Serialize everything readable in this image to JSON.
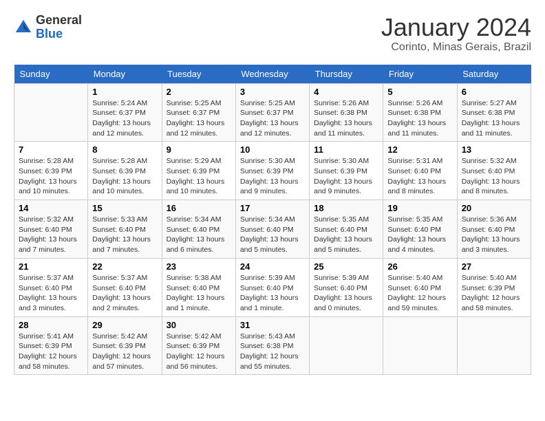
{
  "header": {
    "logo_general": "General",
    "logo_blue": "Blue",
    "month_title": "January 2024",
    "location": "Corinto, Minas Gerais, Brazil"
  },
  "weekdays": [
    "Sunday",
    "Monday",
    "Tuesday",
    "Wednesday",
    "Thursday",
    "Friday",
    "Saturday"
  ],
  "weeks": [
    [
      {
        "day": "",
        "info": ""
      },
      {
        "day": "1",
        "info": "Sunrise: 5:24 AM\nSunset: 6:37 PM\nDaylight: 13 hours and 12 minutes."
      },
      {
        "day": "2",
        "info": "Sunrise: 5:25 AM\nSunset: 6:37 PM\nDaylight: 13 hours and 12 minutes."
      },
      {
        "day": "3",
        "info": "Sunrise: 5:25 AM\nSunset: 6:37 PM\nDaylight: 13 hours and 12 minutes."
      },
      {
        "day": "4",
        "info": "Sunrise: 5:26 AM\nSunset: 6:38 PM\nDaylight: 13 hours and 11 minutes."
      },
      {
        "day": "5",
        "info": "Sunrise: 5:26 AM\nSunset: 6:38 PM\nDaylight: 13 hours and 11 minutes."
      },
      {
        "day": "6",
        "info": "Sunrise: 5:27 AM\nSunset: 6:38 PM\nDaylight: 13 hours and 11 minutes."
      }
    ],
    [
      {
        "day": "7",
        "info": "Sunrise: 5:28 AM\nSunset: 6:39 PM\nDaylight: 13 hours and 10 minutes."
      },
      {
        "day": "8",
        "info": "Sunrise: 5:28 AM\nSunset: 6:39 PM\nDaylight: 13 hours and 10 minutes."
      },
      {
        "day": "9",
        "info": "Sunrise: 5:29 AM\nSunset: 6:39 PM\nDaylight: 13 hours and 10 minutes."
      },
      {
        "day": "10",
        "info": "Sunrise: 5:30 AM\nSunset: 6:39 PM\nDaylight: 13 hours and 9 minutes."
      },
      {
        "day": "11",
        "info": "Sunrise: 5:30 AM\nSunset: 6:39 PM\nDaylight: 13 hours and 9 minutes."
      },
      {
        "day": "12",
        "info": "Sunrise: 5:31 AM\nSunset: 6:40 PM\nDaylight: 13 hours and 8 minutes."
      },
      {
        "day": "13",
        "info": "Sunrise: 5:32 AM\nSunset: 6:40 PM\nDaylight: 13 hours and 8 minutes."
      }
    ],
    [
      {
        "day": "14",
        "info": "Sunrise: 5:32 AM\nSunset: 6:40 PM\nDaylight: 13 hours and 7 minutes."
      },
      {
        "day": "15",
        "info": "Sunrise: 5:33 AM\nSunset: 6:40 PM\nDaylight: 13 hours and 7 minutes."
      },
      {
        "day": "16",
        "info": "Sunrise: 5:34 AM\nSunset: 6:40 PM\nDaylight: 13 hours and 6 minutes."
      },
      {
        "day": "17",
        "info": "Sunrise: 5:34 AM\nSunset: 6:40 PM\nDaylight: 13 hours and 5 minutes."
      },
      {
        "day": "18",
        "info": "Sunrise: 5:35 AM\nSunset: 6:40 PM\nDaylight: 13 hours and 5 minutes."
      },
      {
        "day": "19",
        "info": "Sunrise: 5:35 AM\nSunset: 6:40 PM\nDaylight: 13 hours and 4 minutes."
      },
      {
        "day": "20",
        "info": "Sunrise: 5:36 AM\nSunset: 6:40 PM\nDaylight: 13 hours and 3 minutes."
      }
    ],
    [
      {
        "day": "21",
        "info": "Sunrise: 5:37 AM\nSunset: 6:40 PM\nDaylight: 13 hours and 3 minutes."
      },
      {
        "day": "22",
        "info": "Sunrise: 5:37 AM\nSunset: 6:40 PM\nDaylight: 13 hours and 2 minutes."
      },
      {
        "day": "23",
        "info": "Sunrise: 5:38 AM\nSunset: 6:40 PM\nDaylight: 13 hours and 1 minute."
      },
      {
        "day": "24",
        "info": "Sunrise: 5:39 AM\nSunset: 6:40 PM\nDaylight: 13 hours and 1 minute."
      },
      {
        "day": "25",
        "info": "Sunrise: 5:39 AM\nSunset: 6:40 PM\nDaylight: 13 hours and 0 minutes."
      },
      {
        "day": "26",
        "info": "Sunrise: 5:40 AM\nSunset: 6:40 PM\nDaylight: 12 hours and 59 minutes."
      },
      {
        "day": "27",
        "info": "Sunrise: 5:40 AM\nSunset: 6:39 PM\nDaylight: 12 hours and 58 minutes."
      }
    ],
    [
      {
        "day": "28",
        "info": "Sunrise: 5:41 AM\nSunset: 6:39 PM\nDaylight: 12 hours and 58 minutes."
      },
      {
        "day": "29",
        "info": "Sunrise: 5:42 AM\nSunset: 6:39 PM\nDaylight: 12 hours and 57 minutes."
      },
      {
        "day": "30",
        "info": "Sunrise: 5:42 AM\nSunset: 6:39 PM\nDaylight: 12 hours and 56 minutes."
      },
      {
        "day": "31",
        "info": "Sunrise: 5:43 AM\nSunset: 6:38 PM\nDaylight: 12 hours and 55 minutes."
      },
      {
        "day": "",
        "info": ""
      },
      {
        "day": "",
        "info": ""
      },
      {
        "day": "",
        "info": ""
      }
    ]
  ]
}
